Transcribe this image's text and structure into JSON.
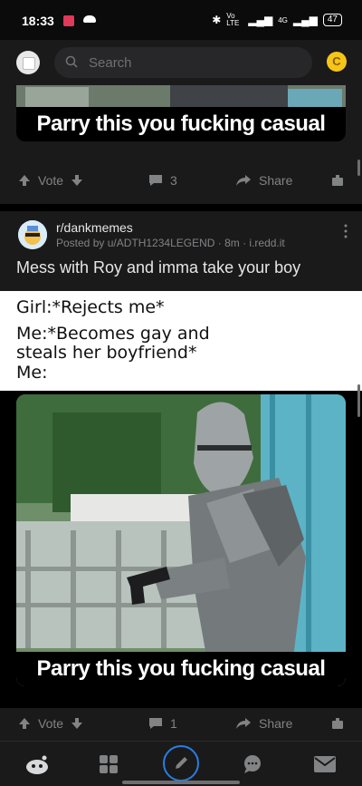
{
  "status": {
    "time": "18:33",
    "network": "Vo LTE",
    "signal": "4G",
    "battery": "47"
  },
  "header": {
    "search_placeholder": "Search",
    "coin_label": "C"
  },
  "post_prev": {
    "image_caption": "Parry this you fucking casual",
    "vote_label": "Vote",
    "comments": "3",
    "share_label": "Share"
  },
  "post": {
    "subreddit": "r/dankmemes",
    "meta": "Posted by u/ADTH1234LEGEND · 8m · i.redd.it",
    "title": "Mess with Roy and imma take your boy",
    "meme_lines": [
      "Girl:*Rejects me*",
      "Me:*Becomes gay and",
      "steals her boyfriend*",
      "Me:"
    ],
    "image_caption": "Parry this you fucking casual",
    "vote_label": "Vote",
    "comments": "1",
    "share_label": "Share"
  },
  "colors": {
    "background": "#0b0b0c",
    "card": "#1a1a1b",
    "muted": "#818384",
    "coin": "#f5c518",
    "nav_accent": "#2a7de1"
  },
  "nav": {
    "items": [
      "home-icon",
      "communities-icon",
      "create-icon",
      "chat-icon",
      "inbox-icon"
    ]
  }
}
